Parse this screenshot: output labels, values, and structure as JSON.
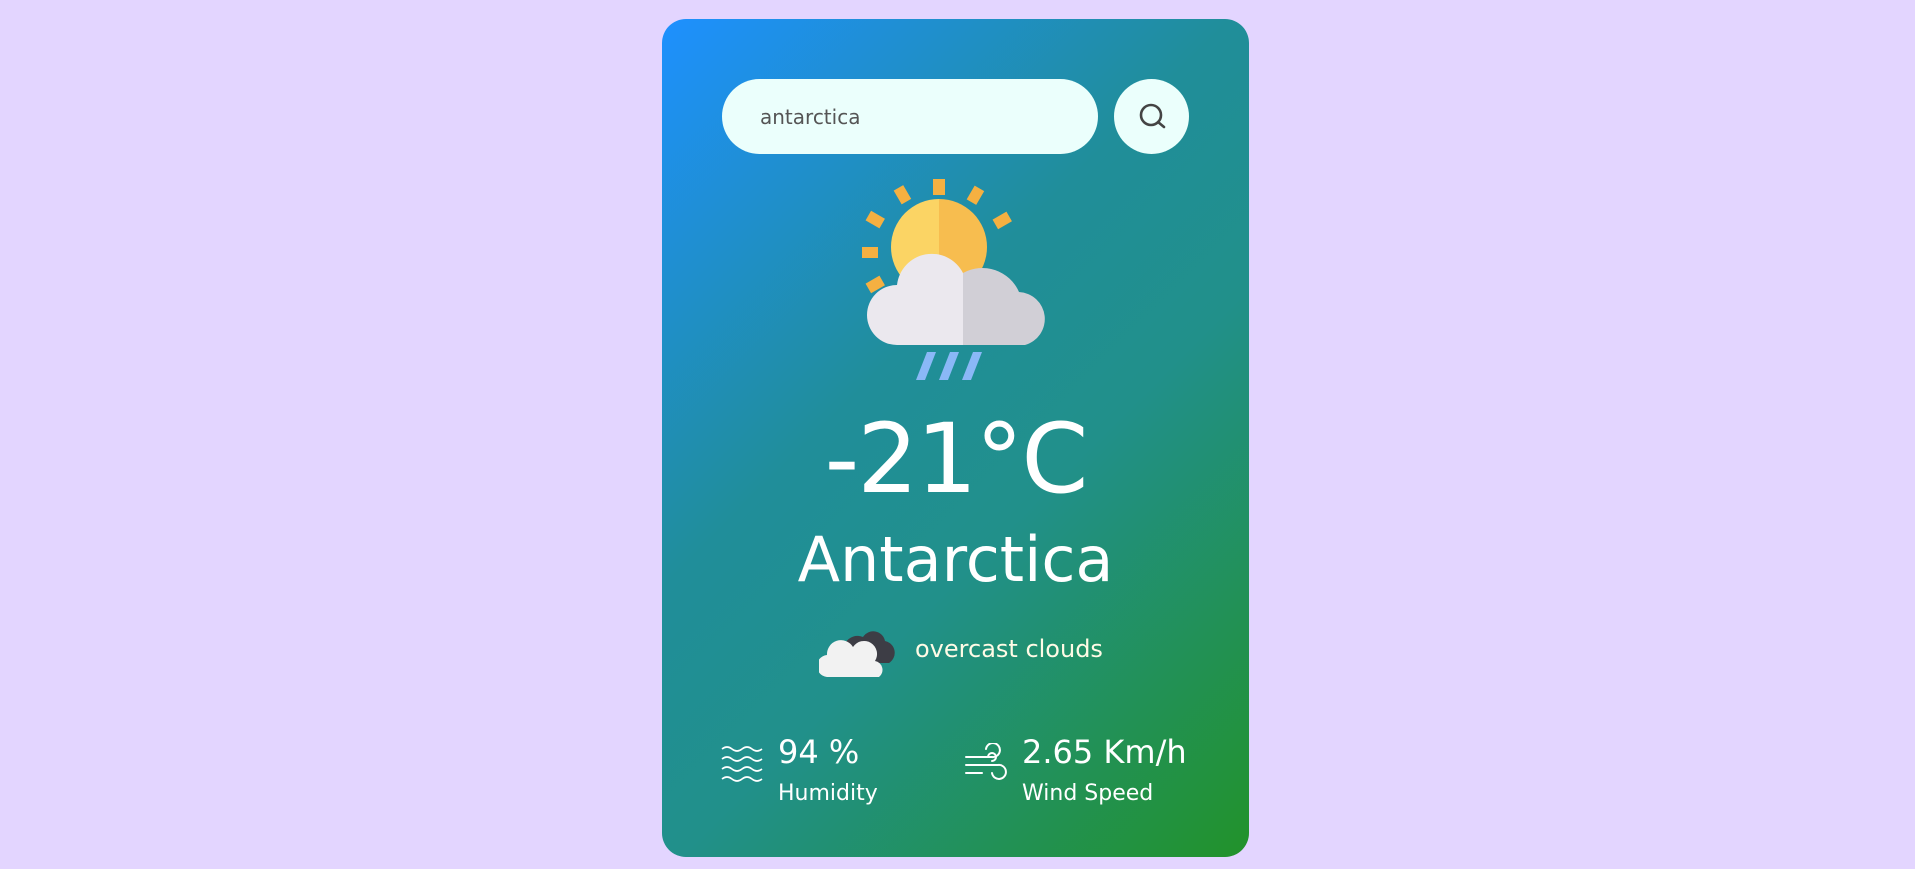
{
  "search": {
    "value": "antarctica",
    "placeholder": ""
  },
  "weather": {
    "icon": "sun-cloud-rain-icon",
    "temperature": "-21°C",
    "city": "Antarctica",
    "description_icon": "overcast-clouds-icon",
    "description": "overcast clouds"
  },
  "stats": {
    "humidity": {
      "icon": "humidity-waves-icon",
      "value": "94 %",
      "label": "Humidity"
    },
    "wind": {
      "icon": "wind-icon",
      "value": "2.65 Km/h",
      "label": "Wind Speed"
    }
  },
  "colors": {
    "page_background": "#e3d5ff",
    "card_gradient_start": "#1e90ff",
    "card_gradient_end": "#22922a",
    "search_background": "#ebfffc"
  }
}
